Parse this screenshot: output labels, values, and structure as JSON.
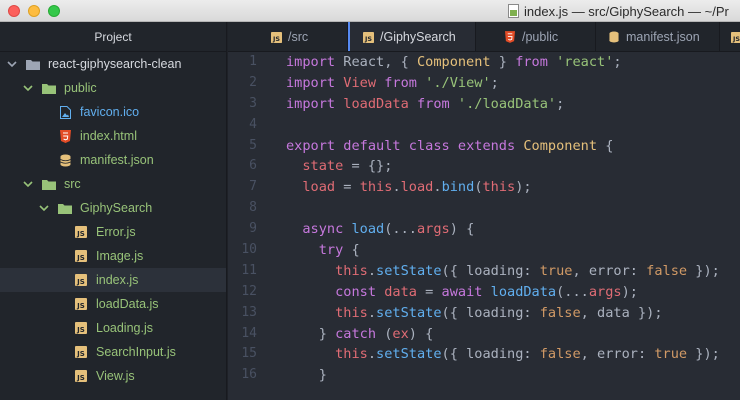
{
  "window": {
    "title": "index.js — src/GiphySearch — ~/Pr",
    "traffic_lights": [
      "close",
      "minimize",
      "zoom"
    ]
  },
  "sidebar": {
    "header": "Project",
    "tree": [
      {
        "label": "react-giphysearch-clean",
        "kind": "root-folder",
        "expanded": true
      },
      {
        "label": "public",
        "kind": "folder",
        "expanded": true
      },
      {
        "label": "favicon.ico",
        "kind": "file",
        "icon": "image-icon"
      },
      {
        "label": "index.html",
        "kind": "file",
        "icon": "html5-icon"
      },
      {
        "label": "manifest.json",
        "kind": "file",
        "icon": "database-icon"
      },
      {
        "label": "src",
        "kind": "folder",
        "expanded": true
      },
      {
        "label": "GiphySearch",
        "kind": "folder",
        "expanded": true
      },
      {
        "label": "Error.js",
        "kind": "file",
        "icon": "js-icon"
      },
      {
        "label": "Image.js",
        "kind": "file",
        "icon": "js-icon"
      },
      {
        "label": "index.js",
        "kind": "file",
        "icon": "js-icon",
        "selected": true
      },
      {
        "label": "loadData.js",
        "kind": "file",
        "icon": "js-icon"
      },
      {
        "label": "Loading.js",
        "kind": "file",
        "icon": "js-icon"
      },
      {
        "label": "SearchInput.js",
        "kind": "file",
        "icon": "js-icon"
      },
      {
        "label": "View.js",
        "kind": "file",
        "icon": "js-icon"
      }
    ]
  },
  "tabs": [
    {
      "label": "/src",
      "icon": "js-icon",
      "active": false
    },
    {
      "label": "/GiphySearch",
      "icon": "js-icon",
      "active": true
    },
    {
      "label": "/public",
      "icon": "html5-icon",
      "active": false
    },
    {
      "label": "manifest.json",
      "icon": "database-icon",
      "active": false
    }
  ],
  "editor": {
    "line_numbers": [
      "1",
      "2",
      "3",
      "4",
      "5",
      "6",
      "7",
      "8",
      "9",
      "10",
      "11",
      "12",
      "13",
      "14",
      "15",
      "16"
    ],
    "tokens": {
      "l1": [
        "import",
        " React, { ",
        "Component",
        " } ",
        "from",
        " ",
        "'react'",
        ";"
      ],
      "l2": [
        "import",
        " ",
        "View",
        " ",
        "from",
        " ",
        "'./View'",
        ";"
      ],
      "l3": [
        "import",
        " ",
        "loadData",
        " ",
        "from",
        " ",
        "'./loadData'",
        ";"
      ],
      "l5": [
        "export",
        " ",
        "default",
        " ",
        "class",
        " ",
        "extends",
        " ",
        "Component",
        " {"
      ],
      "l6": [
        "  ",
        "state",
        " = {};"
      ],
      "l7": [
        "  ",
        "load",
        " = ",
        "this",
        ".",
        "load",
        ".",
        "bind",
        "(",
        "this",
        ");"
      ],
      "l9": [
        "  ",
        "async",
        " ",
        "load",
        "(...",
        "args",
        ") {"
      ],
      "l10": [
        "    ",
        "try",
        " {"
      ],
      "l11": [
        "      ",
        "this",
        ".",
        "setState",
        "({ loading: ",
        "true",
        ", error: ",
        "false",
        " });"
      ],
      "l12": [
        "      ",
        "const",
        " ",
        "data",
        " = ",
        "await",
        " ",
        "loadData",
        "(...",
        "args",
        ");"
      ],
      "l13": [
        "      ",
        "this",
        ".",
        "setState",
        "({ loading: ",
        "false",
        ", data });"
      ],
      "l14": [
        "    } ",
        "catch",
        " (",
        "ex",
        ") {"
      ],
      "l15": [
        "      ",
        "this",
        ".",
        "setState",
        "({ loading: ",
        "false",
        ", error: ",
        "true",
        " });"
      ],
      "l16": [
        "    }"
      ]
    }
  },
  "colors": {
    "keyword": "#c678dd",
    "class": "#e5c07b",
    "string": "#98c379",
    "variable": "#e06c75",
    "function": "#61afef",
    "boolean": "#d19a66",
    "accent": "#568af2"
  }
}
